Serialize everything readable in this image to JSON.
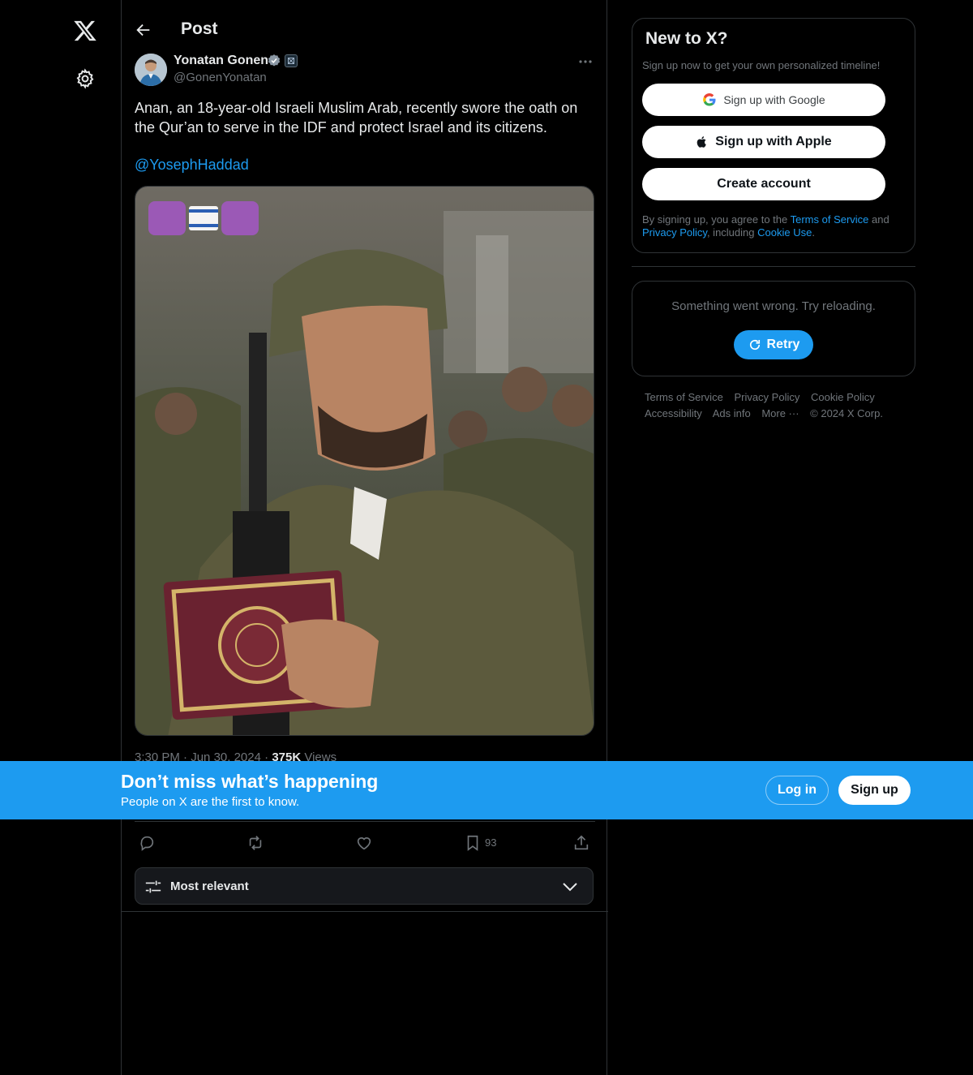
{
  "header": {
    "title": "Post"
  },
  "post": {
    "author_name": "Yonatan Gonen",
    "author_handle": "@GonenYonatan",
    "text": "Anan, an 18-year-old Israeli Muslim Arab, recently swore the oath on the Qur’an to serve in the IDF and protect Israel and its citizens.",
    "mention": "@YosephHaddad",
    "media_overlay_emojis": [
      "☪",
      "🇮🇱",
      "✡"
    ],
    "time": "3:30 PM",
    "date": "Jun 30, 2024",
    "views_count": "375K",
    "views_label": "Views",
    "bookmark_count": "93"
  },
  "sort": {
    "label": "Most relevant"
  },
  "signup": {
    "title": "New to X?",
    "subtitle": "Sign up now to get your own personalized timeline!",
    "google_label": "Sign up with Google",
    "apple_label": "Sign up with Apple",
    "create_label": "Create account",
    "legal_prefix": "By signing up, you agree to the ",
    "terms": "Terms of Service",
    "and": " and ",
    "privacy": "Privacy Policy",
    "including": ", including ",
    "cookie": "Cookie Use",
    "period": "."
  },
  "error": {
    "message": "Something went wrong. Try reloading.",
    "retry_label": "Retry"
  },
  "footer": {
    "links": [
      "Terms of Service",
      "Privacy Policy",
      "Cookie Policy",
      "Accessibility",
      "Ads info",
      "More ···",
      "© 2024 X Corp."
    ]
  },
  "banner": {
    "title": "Don’t miss what’s happening",
    "subtitle": "People on X are the first to know.",
    "login_label": "Log in",
    "signup_label": "Sign up"
  },
  "colors": {
    "accent": "#1d9bf0",
    "background": "#000000",
    "border": "#2f3336",
    "muted": "#71767b"
  },
  "icons": [
    "x-logo-icon",
    "gear-icon",
    "back-arrow-icon",
    "verified-badge-icon",
    "more-icon",
    "reply-icon",
    "repost-icon",
    "like-icon",
    "bookmark-icon",
    "share-icon",
    "sort-sliders-icon",
    "chevron-down-icon",
    "google-icon",
    "apple-icon",
    "retry-icon"
  ]
}
